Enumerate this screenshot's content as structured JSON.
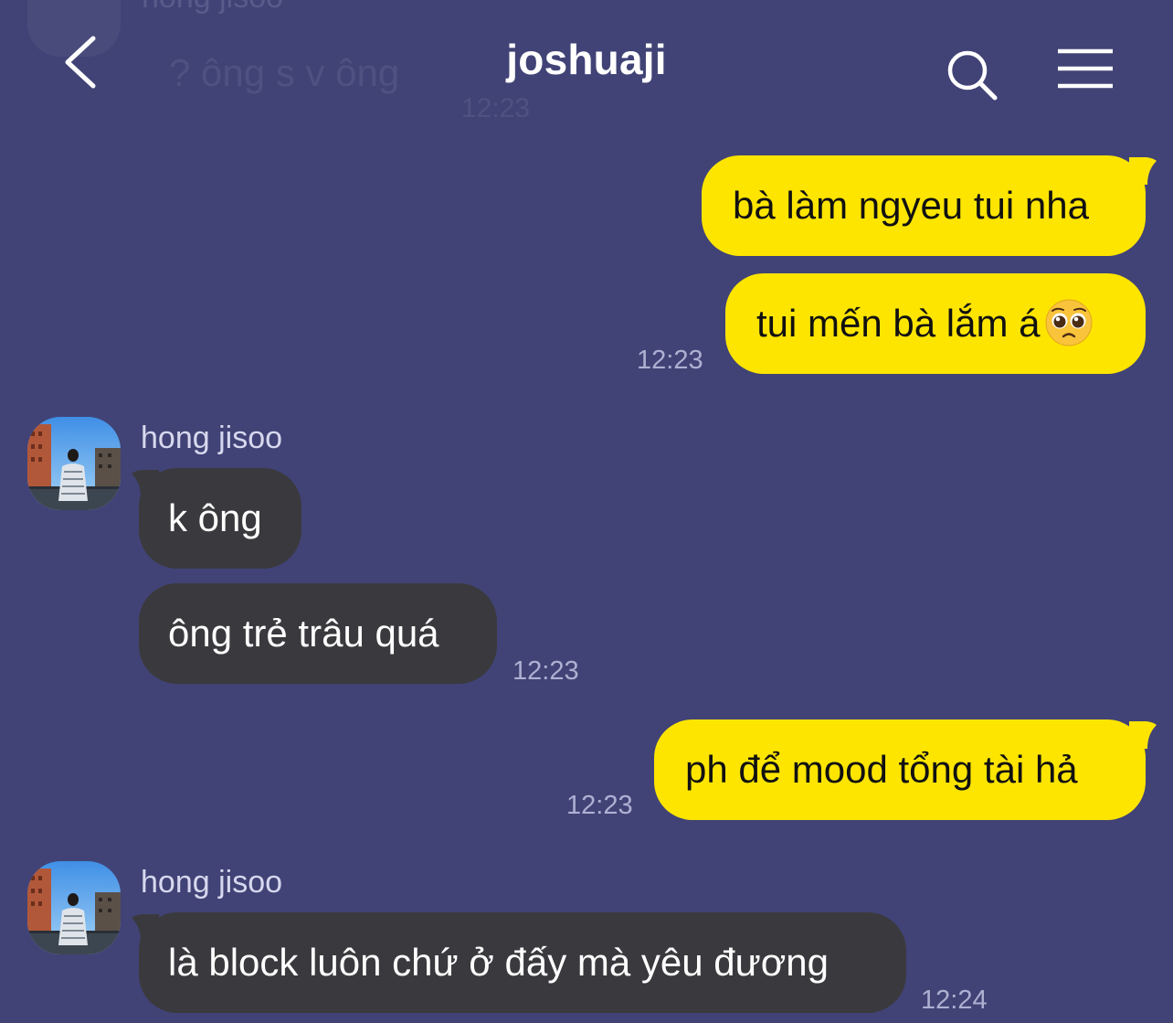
{
  "header": {
    "title": "joshuaji",
    "back_icon": "chevron-left-icon",
    "search_icon": "search-icon",
    "menu_icon": "hamburger-menu-icon"
  },
  "faded_previous": {
    "sender": "hong jisoo",
    "text": "? ông s v ông",
    "time": "12:23"
  },
  "messages": [
    {
      "side": "me",
      "text": "bà làm ngyeu tui nha"
    },
    {
      "side": "me",
      "text": "tui mến bà lắm á",
      "emoji": "pleading-face-emoji",
      "time": "12:23"
    },
    {
      "side": "them",
      "sender": "hong jisoo",
      "text": "k ông"
    },
    {
      "side": "them",
      "text": "ông trẻ trâu quá",
      "time": "12:23"
    },
    {
      "side": "me",
      "text": "ph để mood tổng tài hả",
      "time": "12:23"
    },
    {
      "side": "them",
      "sender": "hong jisoo",
      "text": "là block luôn chứ ở đấy mà yêu đương",
      "time": "12:24"
    }
  ],
  "colors": {
    "background": "#414376",
    "my_bubble": "#fee500",
    "their_bubble": "#3a3a3e",
    "timestamp": "#aeb0d2"
  }
}
